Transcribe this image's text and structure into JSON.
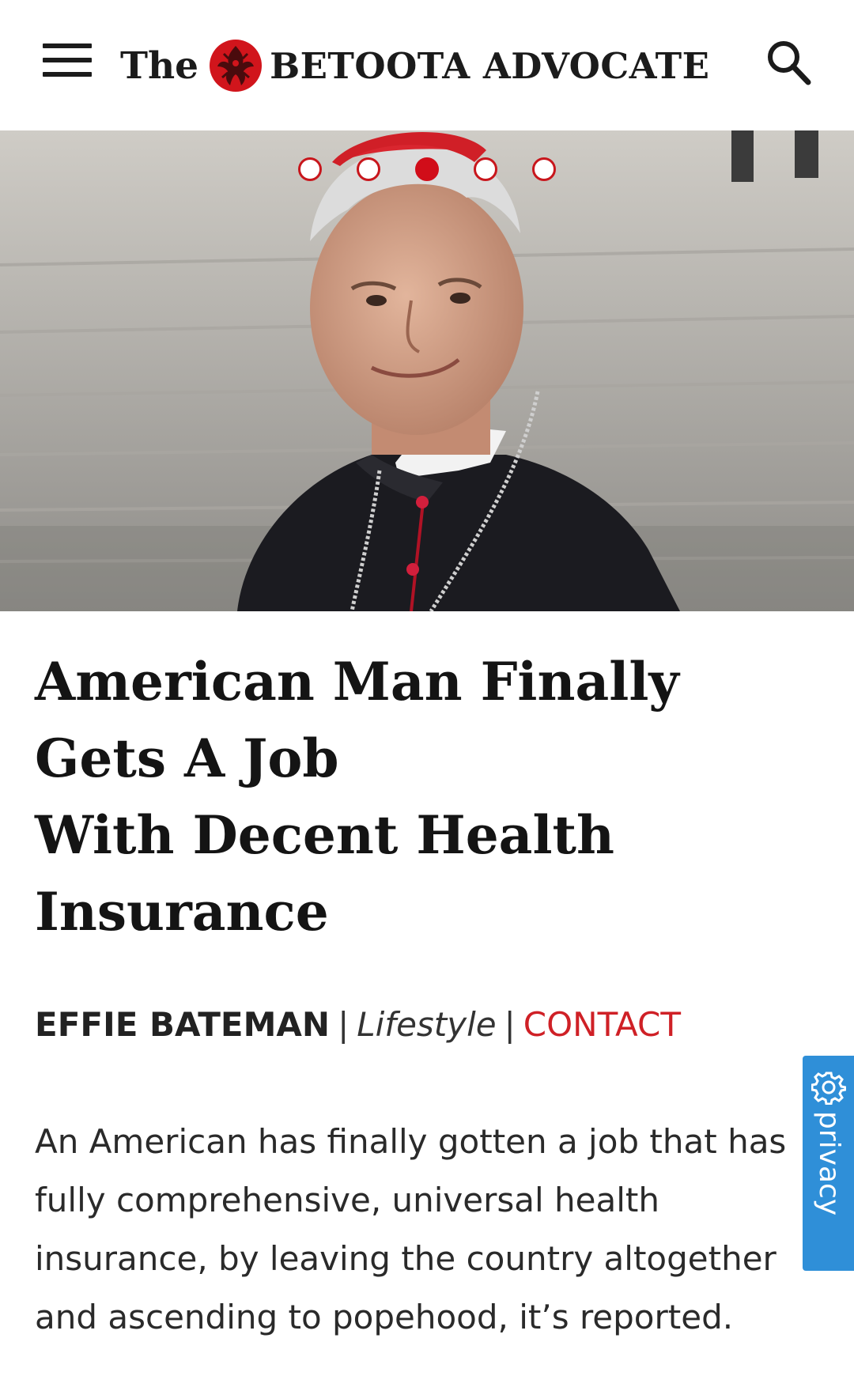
{
  "header": {
    "menu_icon": "hamburger-menu-icon",
    "logo_prefix": "The",
    "logo_name": "BETOOTA ADVOCATE",
    "logo_icon": "crest-logo-icon",
    "search_icon": "search-icon"
  },
  "hero": {
    "carousel": {
      "slide_count": 5,
      "active_index": 2
    }
  },
  "article": {
    "headline_lines": [
      "American Man Finally",
      "Gets A Job",
      "With Decent Health",
      "Insurance"
    ],
    "byline": {
      "author": "EFFIE BATEMAN",
      "separator": "|",
      "category": "Lifestyle",
      "contact": "CONTACT"
    },
    "body_lines": [
      "An American has finally gotten a job that has",
      "fully comprehensive, universal health",
      "insurance, by leaving the country altogether",
      "and ascending to popehood, it’s reported."
    ]
  },
  "privacy_tab": {
    "label": "privacy",
    "icon": "gear-icon"
  },
  "colors": {
    "brand_red": "#cf2026",
    "text_dark": "#1b1b1b",
    "privacy_blue": "#2f8fd8"
  }
}
